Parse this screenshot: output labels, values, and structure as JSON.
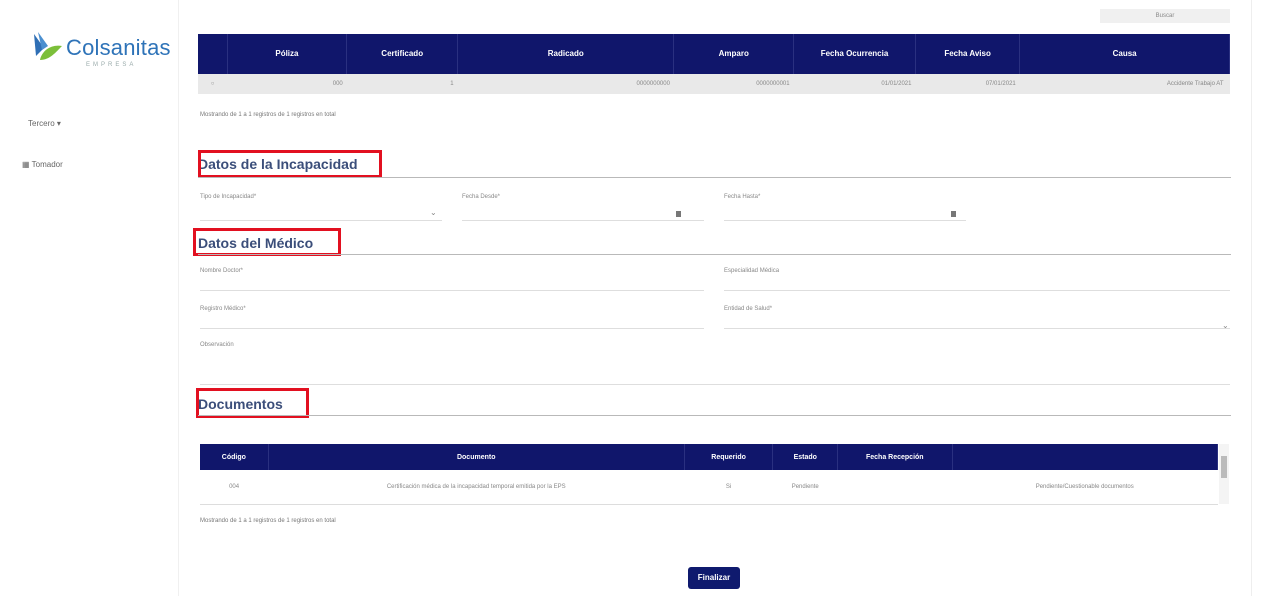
{
  "brand": {
    "name": "Colsanitas",
    "sub": "EMPRESA"
  },
  "nav": {
    "item1": "Tercero ▾",
    "item2": "▦ Tomador"
  },
  "top_button": "Buscar",
  "poliza_table": {
    "headers": [
      "",
      "Póliza",
      "Certificado",
      "Radicado",
      "Amparo",
      "Fecha Ocurrencia",
      "Fecha Aviso",
      "Causa"
    ],
    "row": [
      "○",
      "000",
      "1",
      "0000000000",
      "0000000001",
      "01/01/2021",
      "07/01/2021",
      "Accidente Trabajo AT"
    ]
  },
  "showing1": "Mostrando de 1 a 1 registros de 1 registros en total",
  "sections": {
    "incapacidad": "Datos de la Incapacidad",
    "medico": "Datos del Médico",
    "documentos": "Documentos"
  },
  "incapacidad_fields": {
    "tipo": "Tipo de Incapacidad*",
    "desde": "Fecha Desde*",
    "hasta": "Fecha Hasta*"
  },
  "medico_fields": {
    "nombre": "Nombre Doctor*",
    "especialidad": "Especialidad Médica",
    "registro": "Registro Médico*",
    "entidad": "Entidad de Salud*",
    "observacion": "Observación"
  },
  "documentos_table": {
    "headers": [
      "Código",
      "Documento",
      "Requerido",
      "Estado",
      "Fecha Recepción",
      ""
    ],
    "row": [
      "004",
      "Certificación médica de la incapacidad temporal emitida por la EPS",
      "Si",
      "Pendiente",
      "",
      "Pendiente/Cuestionable documentos"
    ]
  },
  "showing2": "Mostrando de 1 a 1 registros de 1 registros en total",
  "finalize_button": "Finalizar"
}
